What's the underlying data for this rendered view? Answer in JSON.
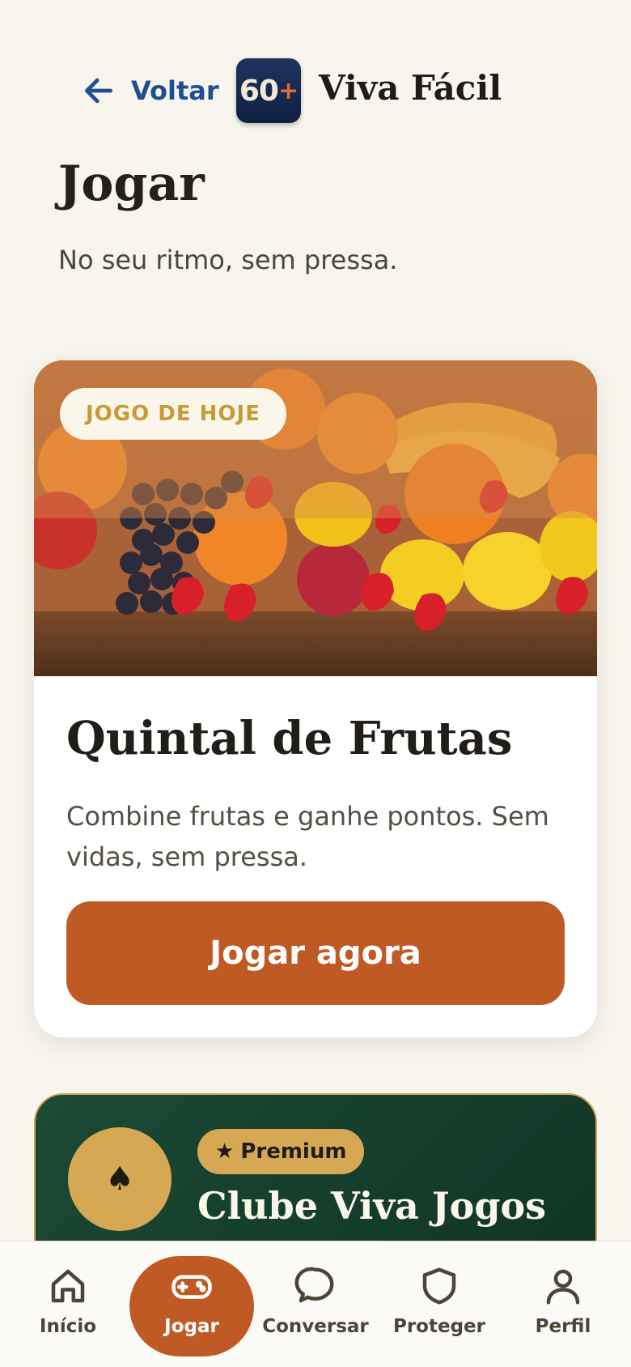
{
  "header": {
    "back_label": "Voltar",
    "logo_number": "60",
    "logo_plus": "+",
    "brand": "Viva Fácil"
  },
  "page": {
    "title": "Jogar",
    "subtitle": "No seu ritmo, sem pressa."
  },
  "game_card": {
    "tag": "JOGO DE HOJE",
    "title": "Quintal de Frutas",
    "description": "Combine frutas e ganhe pontos. Sem vidas, sem pressa.",
    "button": "Jogar agora"
  },
  "premium_card": {
    "badge_star": "★",
    "badge": "Premium",
    "title": "Clube Viva Jogos",
    "icon": "♠"
  },
  "nav": [
    {
      "label": "Início",
      "icon": "home-icon"
    },
    {
      "label": "Jogar",
      "icon": "gamepad-icon",
      "active": true
    },
    {
      "label": "Conversar",
      "icon": "chat-icon"
    },
    {
      "label": "Proteger",
      "icon": "shield-icon"
    },
    {
      "label": "Perfil",
      "icon": "user-icon"
    }
  ],
  "colors": {
    "background": "#f8f5ee",
    "accent": "#c05a24",
    "link": "#1f4f8f",
    "premium_bg": "#1c4a36",
    "gold": "#d7a853"
  }
}
